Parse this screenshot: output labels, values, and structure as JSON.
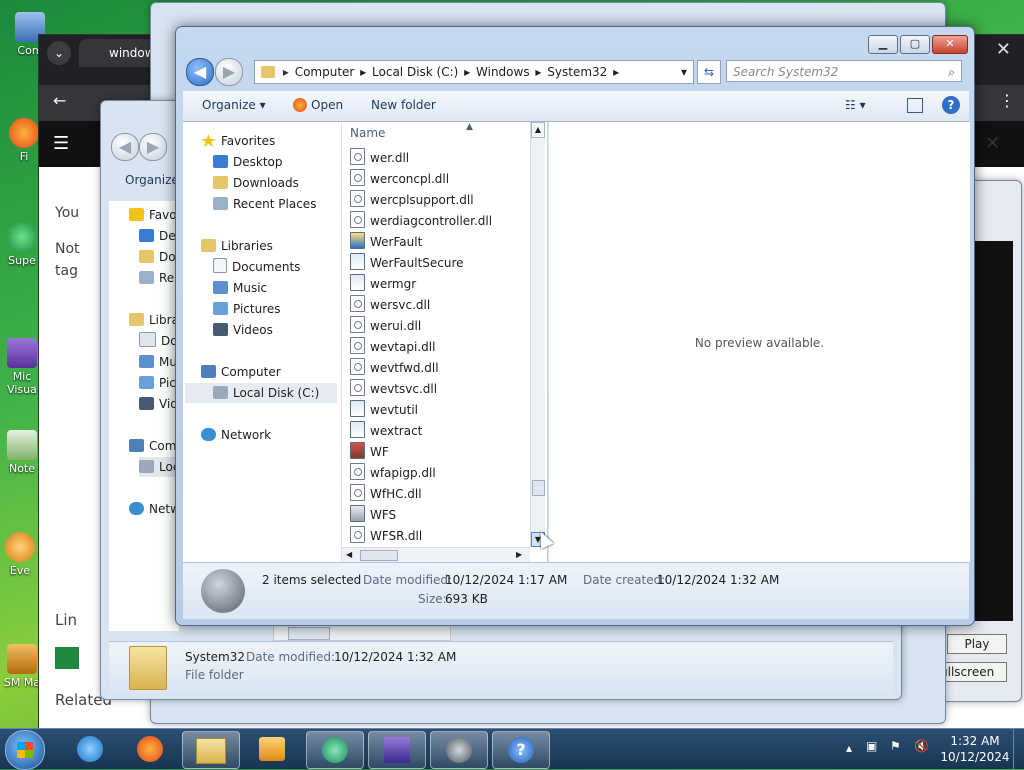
{
  "desktop": {
    "icons": [
      {
        "label": "Com"
      },
      {
        "label": "Fi"
      },
      {
        "label": "Supe"
      },
      {
        "label": "Mic Visua"
      },
      {
        "label": "Note"
      },
      {
        "label": "Eve"
      },
      {
        "label": "SM Ma"
      }
    ]
  },
  "browser": {
    "tab_title": "window",
    "text_fragments": [
      "You",
      "Not",
      "tag",
      "Lin",
      "Related"
    ]
  },
  "background_explorer": {
    "toolbar_organize": "Organize",
    "nav": [
      "Favo",
      "Des",
      "Do",
      "Re",
      "Libra",
      "Do",
      "Mu",
      "Pic",
      "Vid",
      "Com",
      "Loc",
      "Netw"
    ],
    "details": {
      "name": "System32",
      "modified_label": "Date modified:",
      "modified_value": "10/12/2024 1:32 AM",
      "type": "File folder"
    }
  },
  "media_window": {
    "play_label": "Play",
    "fullscreen_label": "Fullscreen"
  },
  "explorer": {
    "breadcrumbs": [
      "Computer",
      "Local Disk (C:)",
      "Windows",
      "System32"
    ],
    "search_placeholder": "Search System32",
    "toolbar": {
      "organize": "Organize",
      "open": "Open",
      "new_folder": "New folder"
    },
    "nav": {
      "favorites": "Favorites",
      "desktop": "Desktop",
      "downloads": "Downloads",
      "recent_places": "Recent Places",
      "libraries": "Libraries",
      "documents": "Documents",
      "music": "Music",
      "pictures": "Pictures",
      "videos": "Videos",
      "computer": "Computer",
      "local_disk": "Local Disk (C:)",
      "network": "Network"
    },
    "column_name": "Name",
    "files": [
      {
        "name": "wer.dll",
        "icon": "dll"
      },
      {
        "name": "werconcpl.dll",
        "icon": "dll"
      },
      {
        "name": "wercplsupport.dll",
        "icon": "dll"
      },
      {
        "name": "werdiagcontroller.dll",
        "icon": "dll"
      },
      {
        "name": "WerFault",
        "icon": "app-shield"
      },
      {
        "name": "WerFaultSecure",
        "icon": "app"
      },
      {
        "name": "wermgr",
        "icon": "app"
      },
      {
        "name": "wersvc.dll",
        "icon": "dll"
      },
      {
        "name": "werui.dll",
        "icon": "dll"
      },
      {
        "name": "wevtapi.dll",
        "icon": "dll"
      },
      {
        "name": "wevtfwd.dll",
        "icon": "dll"
      },
      {
        "name": "wevtsvc.dll",
        "icon": "dll"
      },
      {
        "name": "wevtutil",
        "icon": "app"
      },
      {
        "name": "wextract",
        "icon": "app"
      },
      {
        "name": "WF",
        "icon": "app-firewall"
      },
      {
        "name": "wfapigp.dll",
        "icon": "dll"
      },
      {
        "name": "WfHC.dll",
        "icon": "dll"
      },
      {
        "name": "WFS",
        "icon": "app-fax"
      },
      {
        "name": "WFSR.dll",
        "icon": "dll"
      }
    ],
    "preview_text": "No preview available.",
    "details": {
      "selection": "2 items selected",
      "modified_label": "Date modified:",
      "modified_value": "10/12/2024 1:17 AM",
      "created_label": "Date created:",
      "created_value": "10/12/2024 1:32 AM",
      "size_label": "Size:",
      "size_value": "693 KB"
    }
  },
  "taskbar": {
    "time": "1:32 AM",
    "date": "10/12/2024"
  },
  "colors": {
    "accent": "#2e6ec7",
    "taskbar": "#1e3f63",
    "window_frame": "#b7cce6"
  }
}
